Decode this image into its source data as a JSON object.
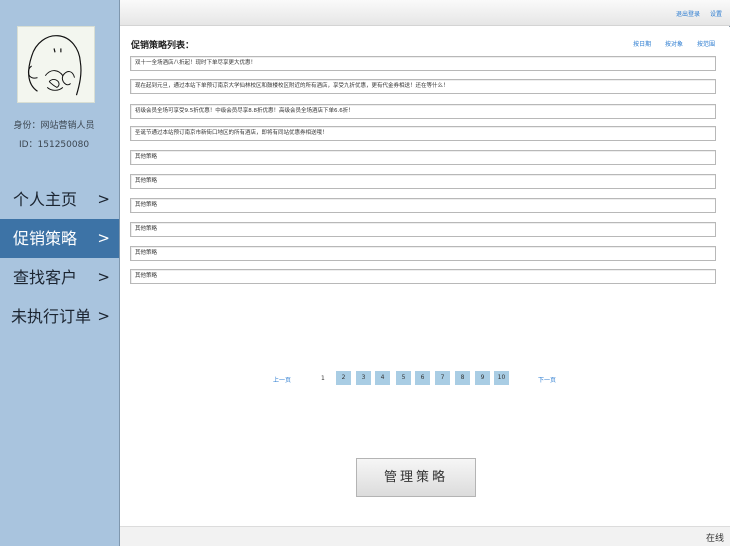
{
  "sidebar": {
    "identity_role": "身份：网站营销人员",
    "identity_id": "ID：151250080",
    "nav": [
      {
        "label": "个人主页",
        "arrow": ">"
      },
      {
        "label": "促销策略",
        "arrow": ">"
      },
      {
        "label": "查找客户",
        "arrow": ">"
      },
      {
        "label": "未执行订单",
        "arrow": ">"
      }
    ]
  },
  "topbar": {
    "logout": "退出登录",
    "settings": "设置"
  },
  "main": {
    "title": "促销策略列表：",
    "sort_by_date": "按日期",
    "sort_by_target": "按对象",
    "sort_by_scope": "按范围",
    "strategies": [
      "双十一全场酒店八折起！现时下单尽享更大优惠！",
      "现在起到元旦，通过本站下单预订南京大学仙林校区和鼓楼校区附近的所有酒店，享受九折优惠，更有代金券相送！还在等什么！",
      "初级会员全场可享受9.5折优惠！中级会员尽享8.8折优惠！高级会员全场酒店下单6.6折！",
      "圣诞节通过本站预订南京市新街口地区的所有酒店，即将有同站优惠券相送哦！",
      "其他策略",
      "其他策略",
      "其他策略",
      "其他策略",
      "其他策略",
      "其他策略"
    ]
  },
  "pagination": {
    "prev": "上一页",
    "current": "1",
    "pages": [
      "2",
      "3",
      "4",
      "5",
      "6",
      "7",
      "8",
      "9",
      "10"
    ],
    "next": "下一页"
  },
  "manage_button": "管理策略",
  "status": "在线"
}
